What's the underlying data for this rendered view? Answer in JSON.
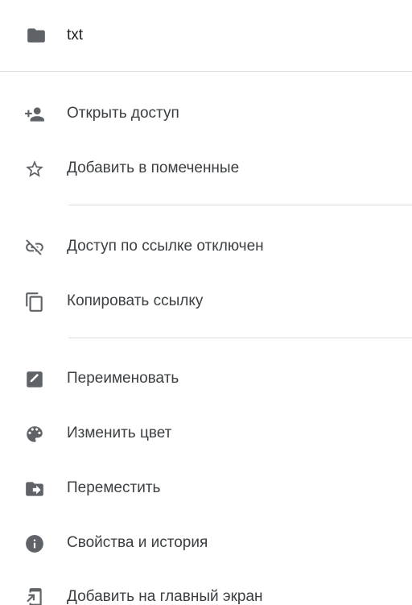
{
  "file": {
    "name": "txt",
    "icon": "folder-icon"
  },
  "menu": {
    "share": {
      "label": "Открыть доступ",
      "icon": "person-add-icon"
    },
    "star": {
      "label": "Добавить в помеченные",
      "icon": "star-outline-icon"
    },
    "link_access": {
      "label": "Доступ по ссылке отключен",
      "icon": "link-off-icon"
    },
    "copy_link": {
      "label": "Копировать ссылку",
      "icon": "copy-icon"
    },
    "rename": {
      "label": "Переименовать",
      "icon": "edit-icon"
    },
    "change_color": {
      "label": "Изменить цвет",
      "icon": "palette-icon"
    },
    "move": {
      "label": "Переместить",
      "icon": "folder-move-icon"
    },
    "details": {
      "label": "Свойства и история",
      "icon": "info-icon"
    },
    "add_home": {
      "label": "Добавить на главный экран",
      "icon": "add-to-home-screen-icon"
    }
  },
  "colors": {
    "icon": "#5f6368",
    "text": "#3c4043",
    "divider": "#dadce0",
    "background": "#ffffff"
  }
}
